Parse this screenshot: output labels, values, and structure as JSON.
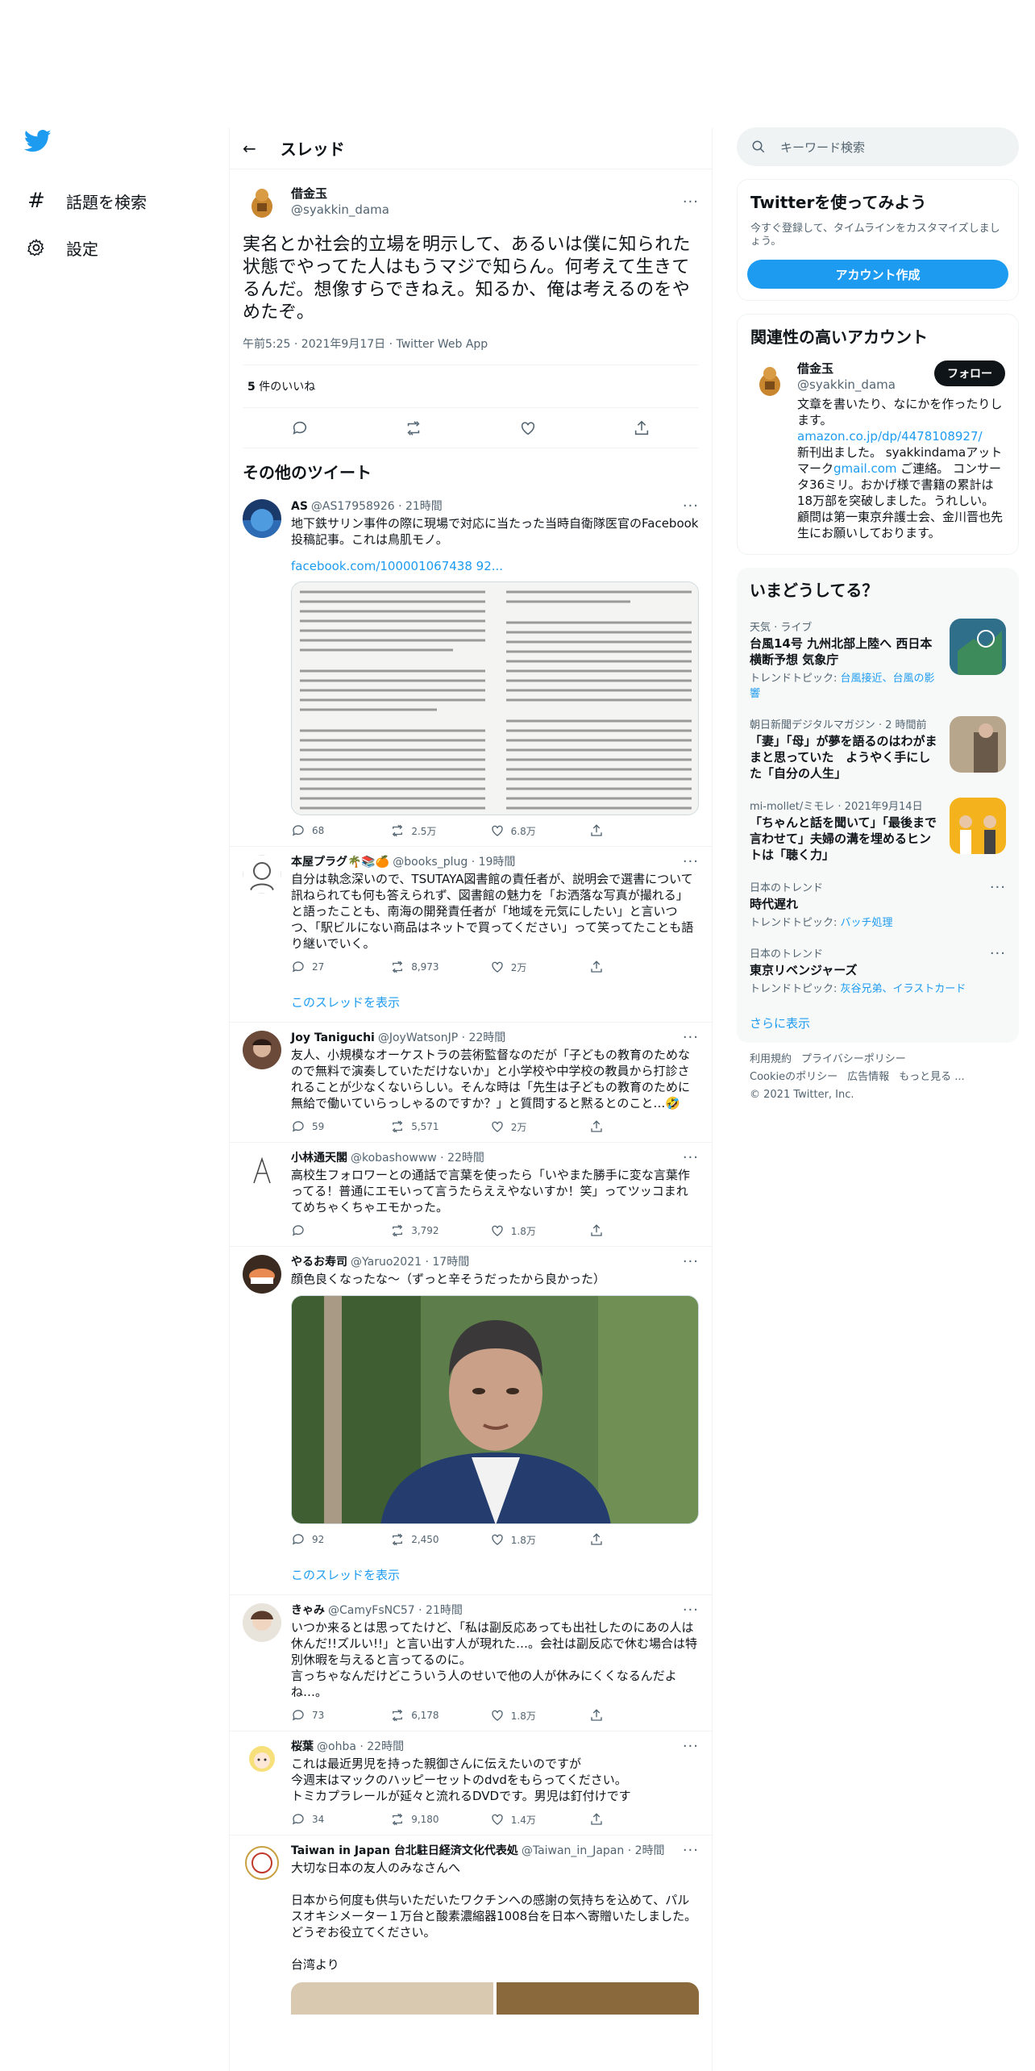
{
  "nav": {
    "explore": "話題を検索",
    "settings": "設定"
  },
  "header": {
    "title": "スレッド"
  },
  "main_tweet": {
    "name": "借金玉",
    "handle": "@syakkin_dama",
    "text": "実名とか社会的立場を明示して、あるいは僕に知られた状態でやってた人はもうマジで知らん。何考えて生きてるんだ。想像すらできねえ。知るか、俺は考えるのをやめたぞ。",
    "meta": "午前5:25 · 2021年9月17日 · Twitter Web App",
    "likes_count": "5",
    "likes_label": " 件のいいね"
  },
  "other_title": "その他のツイート",
  "tweets": [
    {
      "name": "AS",
      "handle": "@AS17958926 · 21時間",
      "text": "地下鉄サリン事件の際に現場で対応に当たった当時自衛隊医官のFacebook投稿記事。これは鳥肌モノ。",
      "link": "facebook.com/100001067438 92...",
      "reply": "68",
      "rt": "2.5万",
      "like": "6.8万"
    },
    {
      "name": "本屋プラグ🌴📚🍊",
      "handle": "@books_plug · 19時間",
      "text": "自分は執念深いので、TSUTAYA図書館の責任者が、説明会で選書について訊ねられても何も答えられず、図書館の魅力を「お洒落な写真が撮れる」と語ったことも、南海の開発責任者が「地域を元気にしたい」と言いつつ、「駅ビルにない商品はネットで買ってください」って笑ってたことも語り継いでいく。",
      "reply": "27",
      "rt": "8,973",
      "like": "2万",
      "show_thread": "このスレッドを表示"
    },
    {
      "name": "Joy Taniguchi",
      "handle": "@JoyWatsonJP · 22時間",
      "text": "友人、小規模なオーケストラの芸術監督なのだが「子どもの教育のためなので無料で演奏していただけないか」と小学校や中学校の教員から打診されることが少なくないらしい。そんな時は「先生は子どもの教育のために無給で働いていらっしゃるのですか？」と質問すると黙るとのこと…🤣",
      "reply": "59",
      "rt": "5,571",
      "like": "2万"
    },
    {
      "name": "小林通天閣",
      "handle": "@kobashowww · 22時間",
      "text": "高校生フォロワーとの通話で言葉を使ったら「いやまた勝手に変な言葉作ってる！普通にエモいって言うたらええやないすか！笑」ってツッコまれてめちゃくちゃエモかった。",
      "reply": "",
      "rt": "3,792",
      "like": "1.8万"
    },
    {
      "name": "やるお寿司",
      "handle": "@Yaruo2021 · 17時間",
      "text": "顔色良くなったな〜（ずっと辛そうだったから良かった）",
      "reply": "92",
      "rt": "2,450",
      "like": "1.8万",
      "show_thread": "このスレッドを表示"
    },
    {
      "name": "きゃみ",
      "handle": "@CamyFsNC57 · 21時間",
      "text": "いつか来るとは思ってたけど、「私は副反応あっても出社したのにあの人は休んだ!!ズルい!!」と言い出す人が現れた…。会社は副反応で休む場合は特別休暇を与えると言ってるのに。\n言っちゃなんだけどこういう人のせいで他の人が休みにくくなるんだよね…。",
      "reply": "73",
      "rt": "6,178",
      "like": "1.8万"
    },
    {
      "name": "桜葉",
      "handle": "@ohba · 22時間",
      "text": "これは最近男児を持った親御さんに伝えたいのですが\n今週末はマックのハッピーセットのdvdをもらってください。\nトミカプラレールが延々と流れるDVDです。男児は釘付けです",
      "reply": "34",
      "rt": "9,180",
      "like": "1.4万"
    },
    {
      "name": "Taiwan in Japan 台北駐日経済文化代表処",
      "handle": "@Taiwan_in_Japan · 2時間",
      "text": "大切な日本の友人のみなさんへ\n\n日本から何度も供与いただいたワクチンへの感謝の気持ちを込めて、パルスオキシメーター１万台と酸素濃縮器1008台を日本へ寄贈いたしました。どうぞお役立てください。\n\n台湾より"
    }
  ],
  "right": {
    "search_placeholder": "キーワード検索",
    "signup_title": "Twitterを使ってみよう",
    "signup_sub": "今すぐ登録して、タイムラインをカスタマイズしましょう。",
    "signup_button": "アカウント作成",
    "relevant_title": "関連性の高いアカウント",
    "rel_name": "借金玉",
    "rel_handle": "@syakkin_dama",
    "follow": "フォロー",
    "bio_a": "文章を書いたり、なにかを作ったりします。",
    "bio_link": "amazon.co.jp/dp/4478108927/",
    "bio_b": "新刊出ました。 syakkindamaアットマーク",
    "bio_link2": "gmail.com",
    "bio_c": " ご連絡。 コンサータ36ミリ。おかげ様で書籍の累計は18万部を突破しました。うれしい。顧問は第一東京弁護士会、金川晋也先生にお願いしております。",
    "trends_title": "いまどうしてる？",
    "trends": [
      {
        "meta": "天気 · ライブ",
        "title": "台風14号 九州北部上陸へ 西日本横断予想 気象庁",
        "topic_label": "トレンドトピック: ",
        "topic": "台風接近、台風の影響"
      },
      {
        "meta": "朝日新聞デジタルマガジン · 2 時間前",
        "title": "「妻」「母」が夢を語るのはわがままと思っていた　ようやく手にした「自分の人生」"
      },
      {
        "meta": "mi-mollet/ミモレ · 2021年9月14日",
        "title": "「ちゃんと話を聞いて」「最後まで言わせて」夫婦の溝を埋めるヒントは「聴く力」"
      },
      {
        "meta": "日本のトレンド",
        "title": "時代遅れ",
        "topic_label": "トレンドトピック: ",
        "topic": "バッチ処理"
      },
      {
        "meta": "日本のトレンド",
        "title": "東京リベンジャーズ",
        "topic_label": "トレンドトピック: ",
        "topic": "灰谷兄弟、イラストカード"
      }
    ],
    "show_more": "さらに表示",
    "footer": [
      "利用規約",
      "プライバシーポリシー",
      "Cookieのポリシー",
      "広告情報",
      "もっと見る ...",
      "© 2021 Twitter, Inc."
    ]
  },
  "colors": {
    "accent": "#1d9bf0",
    "text": "#0f1419",
    "muted": "#536471",
    "border": "#eff3f4"
  }
}
